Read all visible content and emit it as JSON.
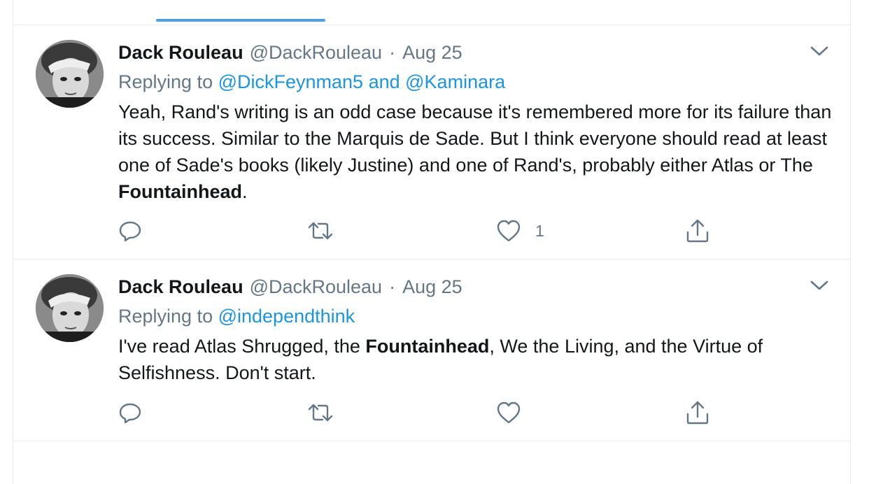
{
  "tweets": [
    {
      "name": "Dack Rouleau",
      "handle": "@DackRouleau",
      "separator": "·",
      "date": "Aug 25",
      "replying_prefix": "Replying to ",
      "replying_to_1": "@DickFeynman5",
      "replying_and": " and ",
      "replying_to_2": "@Kaminara",
      "text_1": "Yeah, Rand's writing is an odd case because it's remembered more for its failure than its success. Similar to the Marquis de Sade. But I think everyone should read at least one of Sade's books (likely Justine) and one of Rand's, probably either Atlas or The ",
      "text_bold": "Fountainhead",
      "text_2": ".",
      "reply_count": "",
      "retweet_count": "",
      "like_count": "1"
    },
    {
      "name": "Dack Rouleau",
      "handle": "@DackRouleau",
      "separator": "·",
      "date": "Aug 25",
      "replying_prefix": "Replying to ",
      "replying_to_1": "@independthink",
      "text_1": "I've read Atlas Shrugged, the ",
      "text_bold": "Fountainhead",
      "text_2": ", We the Living, and the Virtue of Selfishness. Don't start.",
      "reply_count": "",
      "retweet_count": "",
      "like_count": ""
    }
  ],
  "icons": {
    "reply": "reply-icon",
    "retweet": "retweet-icon",
    "like": "heart-icon",
    "share": "share-icon",
    "menu": "chevron-down-icon"
  },
  "colors": {
    "accent": "#1b95e0",
    "tab_indicator": "#4aa1eb",
    "secondary_text": "#657786",
    "primary_text": "#14171a",
    "border": "#e6ecf0"
  }
}
